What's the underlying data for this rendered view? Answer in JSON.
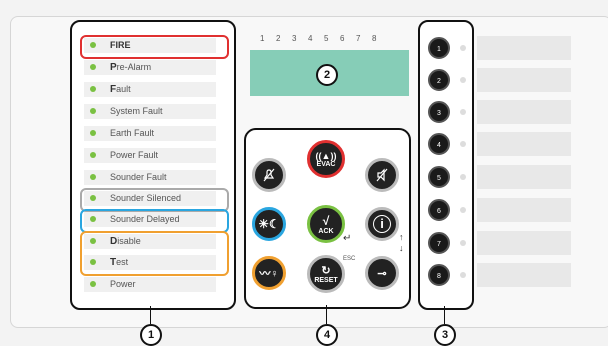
{
  "led_panel": {
    "items": [
      {
        "label": "FIRE",
        "style": "bold-caps"
      },
      {
        "label": "Pre-Alarm",
        "style": "first-bold"
      },
      {
        "label": "Fault",
        "style": "first-bold"
      },
      {
        "label": "System Fault",
        "style": "normal"
      },
      {
        "label": "Earth Fault",
        "style": "normal"
      },
      {
        "label": "Power Fault",
        "style": "normal"
      },
      {
        "label": "Sounder Fault",
        "style": "normal"
      },
      {
        "label": "Sounder Silenced",
        "style": "normal"
      },
      {
        "label": "Sounder Delayed",
        "style": "normal"
      },
      {
        "label": "Disable",
        "style": "first-bold"
      },
      {
        "label": "Test",
        "style": "first-bold"
      },
      {
        "label": "Power",
        "style": "normal"
      }
    ]
  },
  "display": {
    "zone_numbers": [
      "1",
      "2",
      "3",
      "4",
      "5",
      "6",
      "7",
      "8"
    ],
    "color": "#86cdb7"
  },
  "controls": {
    "evac_label": "EVAC",
    "ack_label": "ACK",
    "reset_label": "RESET",
    "esc_label": "ESC"
  },
  "zones": {
    "buttons": [
      "1",
      "2",
      "3",
      "4",
      "5",
      "6",
      "7",
      "8"
    ]
  },
  "callouts": {
    "led": "1",
    "display": "2",
    "zones": "3",
    "controls": "4"
  },
  "colors": {
    "led_green": "#7ac142",
    "fire_frame": "#e03030",
    "silenced_frame": "#aaaaaa",
    "delayed_frame": "#2aa6e0",
    "disable_test_frame": "#f0a030",
    "ack_ring": "#7ac142",
    "evac_ring": "#e03030",
    "daynight_ring": "#2aa6e0",
    "test_ring": "#f0a030"
  }
}
